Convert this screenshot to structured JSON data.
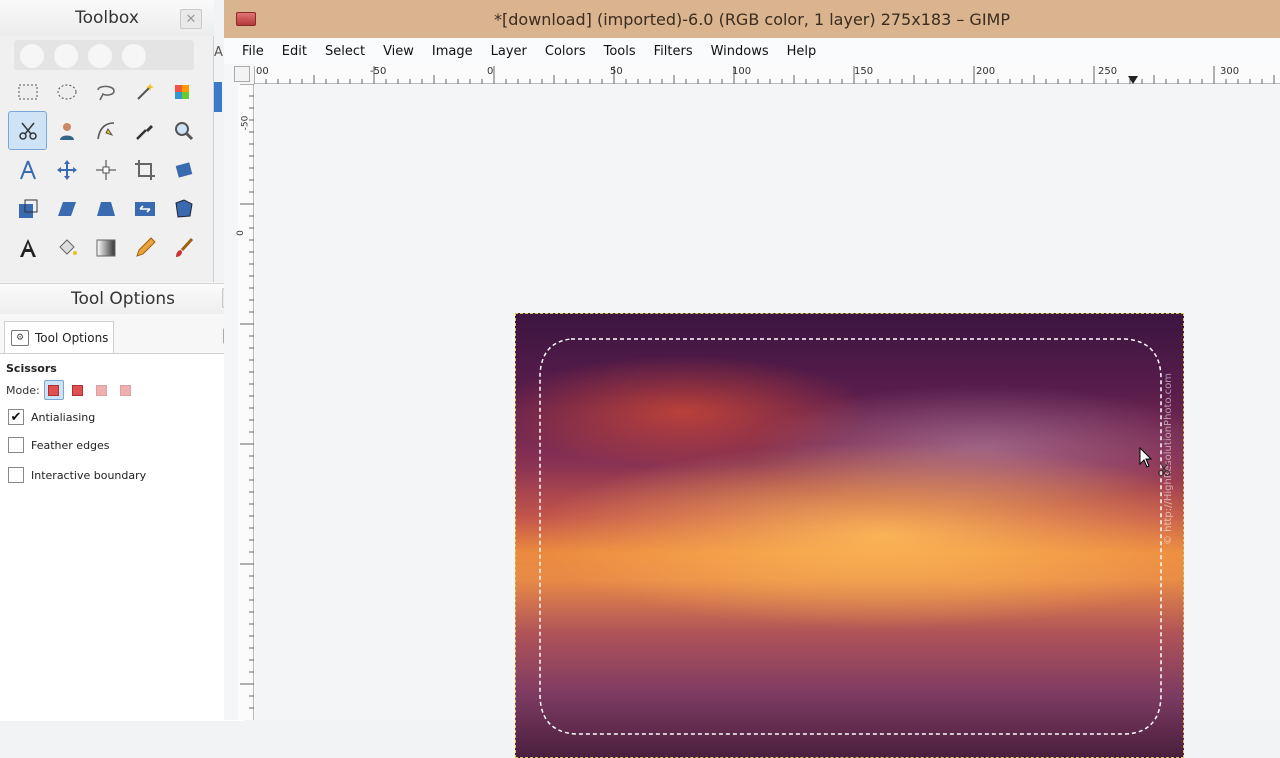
{
  "toolbox": {
    "title": "Toolbox",
    "close_label": "✕",
    "side_letter": "A",
    "tools": [
      {
        "name": "rect-select-icon"
      },
      {
        "name": "ellipse-select-icon"
      },
      {
        "name": "lasso-select-icon"
      },
      {
        "name": "fuzzy-select-icon"
      },
      {
        "name": "color-select-icon"
      },
      {
        "name": "scissors-select-icon",
        "active": true
      },
      {
        "name": "foreground-select-icon"
      },
      {
        "name": "paths-icon"
      },
      {
        "name": "color-picker-icon"
      },
      {
        "name": "zoom-icon"
      },
      {
        "name": "measure-icon"
      },
      {
        "name": "move-icon"
      },
      {
        "name": "align-icon"
      },
      {
        "name": "crop-icon"
      },
      {
        "name": "rotate-icon"
      },
      {
        "name": "scale-icon"
      },
      {
        "name": "shear-icon"
      },
      {
        "name": "perspective-icon"
      },
      {
        "name": "flip-icon"
      },
      {
        "name": "cage-icon"
      },
      {
        "name": "text-icon"
      },
      {
        "name": "bucket-fill-icon"
      },
      {
        "name": "blend-icon"
      },
      {
        "name": "pencil-icon"
      },
      {
        "name": "paintbrush-icon"
      }
    ]
  },
  "tool_options": {
    "title": "Tool Options",
    "close_label": "✕",
    "tab_label": "Tool Options",
    "tool_name": "Scissors",
    "mode_label": "Mode:",
    "options": [
      {
        "label": "Antialiasing",
        "checked": true
      },
      {
        "label": "Feather edges",
        "checked": false
      },
      {
        "label": "Interactive boundary",
        "checked": false
      }
    ]
  },
  "image_window": {
    "title": "*[download] (imported)-6.0 (RGB color, 1 layer) 275x183 – GIMP",
    "menu": [
      "File",
      "Edit",
      "Select",
      "View",
      "Image",
      "Layer",
      "Colors",
      "Tools",
      "Filters",
      "Windows",
      "Help"
    ],
    "ruler_h_labels": [
      "00",
      "-50",
      "0",
      "50",
      "100",
      "150",
      "200",
      "250",
      "300"
    ],
    "ruler_v_labels": [
      "-50",
      "0"
    ],
    "watermark": "© http://HighResolutionPhoto.com"
  },
  "colors": {
    "titlebar": "#d9b48e",
    "selection": "#ffffff",
    "active_tool": "#cfe3f7"
  }
}
